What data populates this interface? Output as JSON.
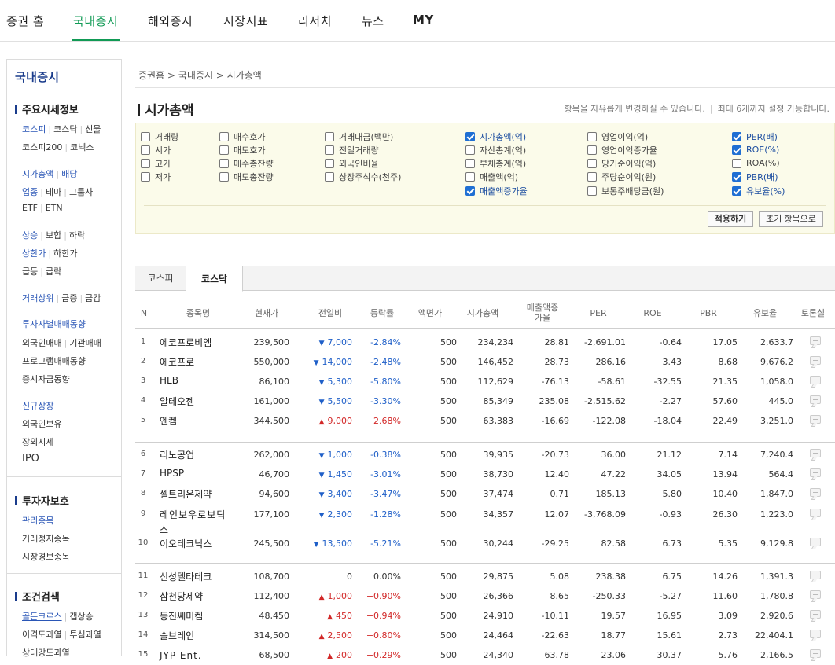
{
  "topnav": {
    "items": [
      {
        "label": "증권 홈",
        "active": false
      },
      {
        "label": "국내증시",
        "active": true
      },
      {
        "label": "해외증시",
        "active": false
      },
      {
        "label": "시장지표",
        "active": false
      },
      {
        "label": "리서치",
        "active": false
      },
      {
        "label": "뉴스",
        "active": false
      },
      {
        "label": "MY",
        "active": false
      }
    ]
  },
  "sidebar": {
    "title": "국내증시",
    "sections": {
      "market": "주요시세정보",
      "investor": "투자자보호",
      "search": "조건검색"
    },
    "links": {
      "kospi": "코스피",
      "kosdaq": "코스닥",
      "futures": "선물",
      "kospi200": "코스피200",
      "konex": "코넥스",
      "marketcap": "시가총액",
      "dividend": "배당",
      "sector": "업종",
      "theme": "테마",
      "group": "그룹사",
      "etf": "ETF",
      "etn": "ETN",
      "rise": "상승",
      "flat": "보합",
      "fall": "하락",
      "upper": "상한가",
      "lower": "하한가",
      "surge": "급등",
      "plunge": "급락",
      "volume_top": "거래상위",
      "jump": "급증",
      "drop": "급감",
      "investor_trade": "투자자별매매동향",
      "foreign_trade": "외국인매매",
      "inst_trade": "기관매매",
      "program_trade": "프로그램매매동향",
      "deposit": "증시자금동향",
      "new_listing": "신규상장",
      "foreign_hold": "외국인보유",
      "otc": "장외시세",
      "ipo": "IPO",
      "managed": "관리종목",
      "halted": "거래정지종목",
      "alert": "시장경보종목",
      "golden": "골든크로스",
      "gap_up": "갭상승",
      "disparity": "이격도과열",
      "psych": "투심과열",
      "relative": "상대강도과열"
    }
  },
  "breadcrumb": "증권홈 > 국내증시 > 시가총액",
  "page_title": "시가총액",
  "hint": {
    "left": "항목을 자유롭게 변경하실 수 있습니다.",
    "sep": "|",
    "right": "최대 6개까지 설정 가능합니다."
  },
  "options": [
    [
      {
        "label": "거래량",
        "checked": false
      },
      {
        "label": "시가",
        "checked": false
      },
      {
        "label": "고가",
        "checked": false
      },
      {
        "label": "저가",
        "checked": false
      }
    ],
    [
      {
        "label": "매수호가",
        "checked": false
      },
      {
        "label": "매도호가",
        "checked": false
      },
      {
        "label": "매수총잔량",
        "checked": false
      },
      {
        "label": "매도총잔량",
        "checked": false
      }
    ],
    [
      {
        "label": "거래대금(백만)",
        "checked": false
      },
      {
        "label": "전일거래량",
        "checked": false
      },
      {
        "label": "외국인비율",
        "checked": false
      },
      {
        "label": "상장주식수(천주)",
        "checked": false
      }
    ],
    [
      {
        "label": "시가총액(억)",
        "checked": true
      },
      {
        "label": "자산총계(억)",
        "checked": false
      },
      {
        "label": "부채총계(억)",
        "checked": false
      },
      {
        "label": "매출액(억)",
        "checked": false
      },
      {
        "label": "매출액증가율",
        "checked": true
      }
    ],
    [
      {
        "label": "영업이익(억)",
        "checked": false
      },
      {
        "label": "영업이익증가율",
        "checked": false
      },
      {
        "label": "당기순이익(억)",
        "checked": false
      },
      {
        "label": "주당순이익(원)",
        "checked": false
      },
      {
        "label": "보통주배당금(원)",
        "checked": false
      }
    ],
    [
      {
        "label": "PER(배)",
        "checked": true
      },
      {
        "label": "ROE(%)",
        "checked": true
      },
      {
        "label": "ROA(%)",
        "checked": false
      },
      {
        "label": "PBR(배)",
        "checked": true
      },
      {
        "label": "유보율(%)",
        "checked": true
      }
    ]
  ],
  "buttons": {
    "apply": "적용하기",
    "reset": "초기 항목으로"
  },
  "tabs": [
    {
      "label": "코스피",
      "active": false
    },
    {
      "label": "코스닥",
      "active": true
    }
  ],
  "columns": [
    "N",
    "종목명",
    "현재가",
    "전일비",
    "등락률",
    "액면가",
    "시가총액",
    "매출액증가율",
    "PER",
    "ROE",
    "PBR",
    "유보율",
    "토론실"
  ],
  "rows": [
    {
      "n": "1",
      "name": "에코프로비엠",
      "price": "239,500",
      "dir": "down",
      "change": "7,000",
      "rate": "-2.84%",
      "par": "500",
      "cap": "234,234",
      "sales_growth": "28.81",
      "per": "-2,691.01",
      "roe": "-0.64",
      "pbr": "17.05",
      "reserve": "2,633.7"
    },
    {
      "n": "2",
      "name": "에코프로",
      "price": "550,000",
      "dir": "down",
      "change": "14,000",
      "rate": "-2.48%",
      "par": "500",
      "cap": "146,452",
      "sales_growth": "28.73",
      "per": "286.16",
      "roe": "3.43",
      "pbr": "8.68",
      "reserve": "9,676.2"
    },
    {
      "n": "3",
      "name": "HLB",
      "price": "86,100",
      "dir": "down",
      "change": "5,300",
      "rate": "-5.80%",
      "par": "500",
      "cap": "112,629",
      "sales_growth": "-76.13",
      "per": "-58.61",
      "roe": "-32.55",
      "pbr": "21.35",
      "reserve": "1,058.0"
    },
    {
      "n": "4",
      "name": "알테오젠",
      "price": "161,000",
      "dir": "down",
      "change": "5,500",
      "rate": "-3.30%",
      "par": "500",
      "cap": "85,349",
      "sales_growth": "235.08",
      "per": "-2,515.62",
      "roe": "-2.27",
      "pbr": "57.60",
      "reserve": "445.0"
    },
    {
      "n": "5",
      "name": "엔켐",
      "price": "344,500",
      "dir": "up",
      "change": "9,000",
      "rate": "+2.68%",
      "par": "500",
      "cap": "63,383",
      "sales_growth": "-16.69",
      "per": "-122.08",
      "roe": "-18.04",
      "pbr": "22.49",
      "reserve": "3,251.0"
    },
    {
      "n": "6",
      "name": "리노공업",
      "price": "262,000",
      "dir": "down",
      "change": "1,000",
      "rate": "-0.38%",
      "par": "500",
      "cap": "39,935",
      "sales_growth": "-20.73",
      "per": "36.00",
      "roe": "21.12",
      "pbr": "7.14",
      "reserve": "7,240.4"
    },
    {
      "n": "7",
      "name": "HPSP",
      "price": "46,700",
      "dir": "down",
      "change": "1,450",
      "rate": "-3.01%",
      "par": "500",
      "cap": "38,730",
      "sales_growth": "12.40",
      "per": "47.22",
      "roe": "34.05",
      "pbr": "13.94",
      "reserve": "564.4"
    },
    {
      "n": "8",
      "name": "셀트리온제약",
      "price": "94,600",
      "dir": "down",
      "change": "3,400",
      "rate": "-3.47%",
      "par": "500",
      "cap": "37,474",
      "sales_growth": "0.71",
      "per": "185.13",
      "roe": "5.80",
      "pbr": "10.40",
      "reserve": "1,847.0"
    },
    {
      "n": "9",
      "name": "레인보우로보틱스",
      "price": "177,100",
      "dir": "down",
      "change": "2,300",
      "rate": "-1.28%",
      "par": "500",
      "cap": "34,357",
      "sales_growth": "12.07",
      "per": "-3,768.09",
      "roe": "-0.93",
      "pbr": "26.30",
      "reserve": "1,223.0"
    },
    {
      "n": "10",
      "name": "이오테크닉스",
      "price": "245,500",
      "dir": "down",
      "change": "13,500",
      "rate": "-5.21%",
      "par": "500",
      "cap": "30,244",
      "sales_growth": "-29.25",
      "per": "82.58",
      "roe": "6.73",
      "pbr": "5.35",
      "reserve": "9,129.8"
    },
    {
      "n": "11",
      "name": "신성델타테크",
      "price": "108,700",
      "dir": "flat",
      "change": "0",
      "rate": "0.00%",
      "par": "500",
      "cap": "29,875",
      "sales_growth": "5.08",
      "per": "238.38",
      "roe": "6.75",
      "pbr": "14.26",
      "reserve": "1,391.3"
    },
    {
      "n": "12",
      "name": "삼천당제약",
      "price": "112,400",
      "dir": "up",
      "change": "1,000",
      "rate": "+0.90%",
      "par": "500",
      "cap": "26,366",
      "sales_growth": "8.65",
      "per": "-250.33",
      "roe": "-5.27",
      "pbr": "11.60",
      "reserve": "1,780.8"
    },
    {
      "n": "13",
      "name": "동진쎄미켐",
      "price": "48,450",
      "dir": "up",
      "change": "450",
      "rate": "+0.94%",
      "par": "500",
      "cap": "24,910",
      "sales_growth": "-10.11",
      "per": "19.57",
      "roe": "16.95",
      "pbr": "3.09",
      "reserve": "2,920.6"
    },
    {
      "n": "14",
      "name": "솔브레인",
      "price": "314,500",
      "dir": "up",
      "change": "2,500",
      "rate": "+0.80%",
      "par": "500",
      "cap": "24,464",
      "sales_growth": "-22.63",
      "per": "18.77",
      "roe": "15.61",
      "pbr": "2.73",
      "reserve": "22,404.1"
    },
    {
      "n": "15",
      "name": "JYP Ent.",
      "price": "68,500",
      "dir": "up",
      "change": "200",
      "rate": "+0.29%",
      "par": "500",
      "cap": "24,340",
      "sales_growth": "63.78",
      "per": "23.06",
      "roe": "30.37",
      "pbr": "5.76",
      "reserve": "2,166.5"
    }
  ],
  "colors": {
    "brand_green": "#119a55",
    "up": "#d22828",
    "down": "#1f5fc8",
    "link_blue": "#2a56b6"
  }
}
